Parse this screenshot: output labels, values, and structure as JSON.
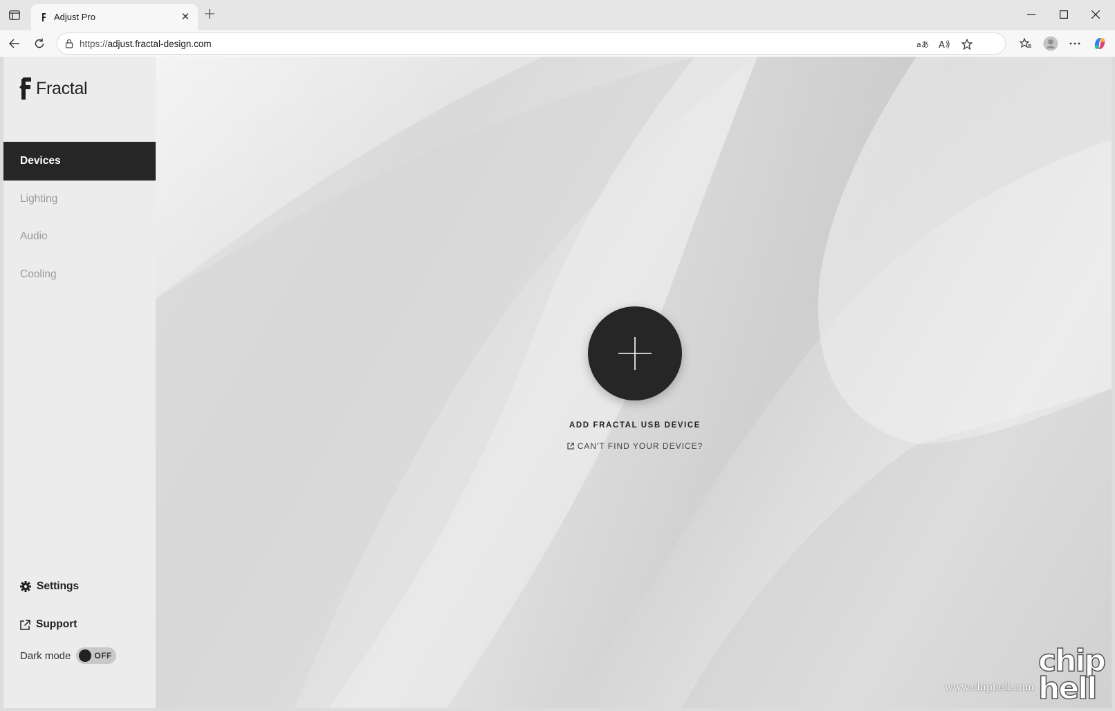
{
  "browser": {
    "tab_title": "Adjust Pro",
    "url_prefix": "https://",
    "url_host": "adjust.fractal-design.com",
    "icons": [
      "sidebar-toggle-icon",
      "close-icon",
      "plus-icon",
      "minimize-icon",
      "maximize-icon",
      "back-icon",
      "refresh-icon",
      "lock-icon",
      "translate-icon",
      "read-aloud-icon",
      "star-icon",
      "favorites-icon",
      "profile-icon",
      "more-icon",
      "copilot-icon"
    ]
  },
  "sidebar": {
    "logo_text": "Fractal",
    "items": [
      {
        "label": "Devices",
        "active": true
      },
      {
        "label": "Lighting",
        "active": false
      },
      {
        "label": "Audio",
        "active": false
      },
      {
        "label": "Cooling",
        "active": false
      }
    ],
    "settings_label": "Settings",
    "support_label": "Support",
    "dark_mode_label": "Dark mode",
    "dark_mode_state": "OFF"
  },
  "main": {
    "add_device_label": "ADD FRACTAL USB DEVICE",
    "help_link_label": "CAN'T FIND YOUR DEVICE?"
  },
  "watermark": {
    "url": "www.chiphell.com",
    "logo": "chip hell"
  },
  "colors": {
    "active_nav_bg": "#262626",
    "inactive_nav_text": "#9a9a9a",
    "sidebar_bg": "#ececec",
    "add_button_bg": "#262626"
  }
}
